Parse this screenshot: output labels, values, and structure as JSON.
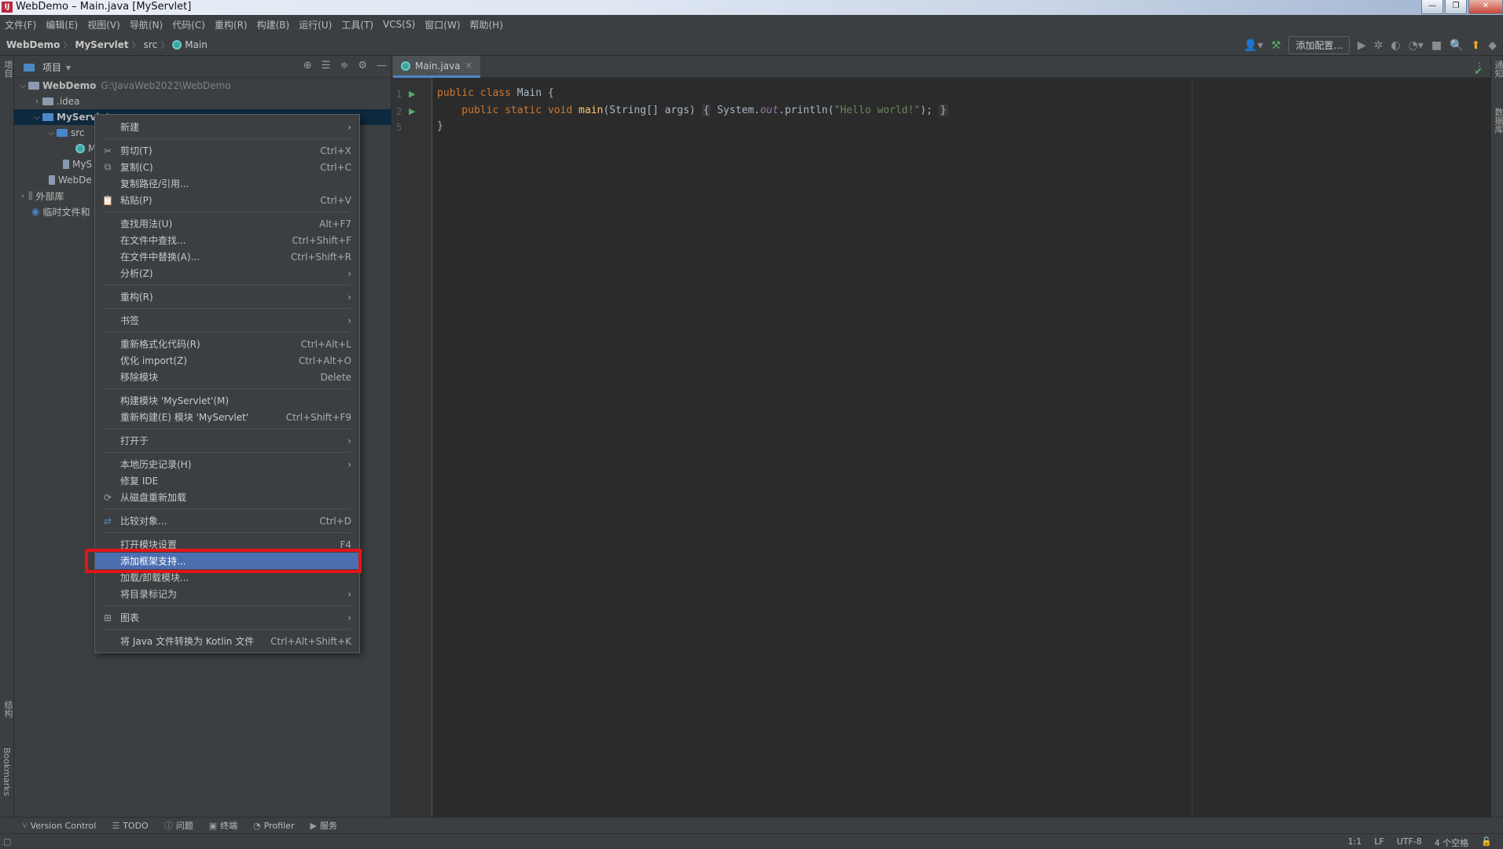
{
  "window": {
    "title": "WebDemo – Main.java [MyServlet]",
    "controls": [
      "minimize-icon",
      "restore-icon",
      "close-icon"
    ]
  },
  "menubar": {
    "items": [
      "文件(F)",
      "编辑(E)",
      "视图(V)",
      "导航(N)",
      "代码(C)",
      "重构(R)",
      "构建(B)",
      "运行(U)",
      "工具(T)",
      "VCS(S)",
      "窗口(W)",
      "帮助(H)"
    ]
  },
  "navbar": {
    "breadcrumbs": [
      "WebDemo",
      "MyServlet",
      "src",
      "Main"
    ],
    "add_config": "添加配置..."
  },
  "left_strip": {
    "top_label": "项目",
    "structure_label": "结构",
    "bookmarks_label": "Bookmarks"
  },
  "right_strip": {
    "notifications_label": "通知",
    "database_label": "数据库"
  },
  "project_panel": {
    "title": "项目",
    "tree": [
      {
        "label": "WebDemo",
        "path": "G:\\JavaWeb2022\\WebDemo"
      },
      {
        "label": ".idea"
      },
      {
        "label": "MyServlet"
      },
      {
        "label": "src"
      },
      {
        "label": "M"
      },
      {
        "label": "MyS"
      },
      {
        "label": "WebDe"
      },
      {
        "label": "外部库"
      },
      {
        "label": "临时文件和"
      }
    ]
  },
  "editor": {
    "tab_label": "Main.java",
    "line_numbers": [
      "1",
      "2",
      "5"
    ],
    "code": {
      "l1_kw": "public class ",
      "l1_name": "Main {",
      "l2_kw": "    public static void ",
      "l2_fn": "main",
      "l2_args": "(String[] args) ",
      "l2_open": "{",
      "l2_body1": " System.",
      "l2_out": "out",
      "l2_body2": ".println(",
      "l2_str": "\"Hello world!\"",
      "l2_end": "); ",
      "l2_close": "}",
      "l3": "}"
    }
  },
  "context_menu": {
    "items": [
      {
        "label": "新建",
        "shortcut": "",
        "submenu": true
      },
      {
        "label": "剪切(T)",
        "shortcut": "Ctrl+X"
      },
      {
        "label": "复制(C)",
        "shortcut": "Ctrl+C"
      },
      {
        "label": "复制路径/引用...",
        "shortcut": ""
      },
      {
        "label": "粘贴(P)",
        "shortcut": "Ctrl+V"
      },
      {
        "label": "查找用法(U)",
        "shortcut": "Alt+F7"
      },
      {
        "label": "在文件中查找...",
        "shortcut": "Ctrl+Shift+F"
      },
      {
        "label": "在文件中替换(A)...",
        "shortcut": "Ctrl+Shift+R"
      },
      {
        "label": "分析(Z)",
        "shortcut": "",
        "submenu": true
      },
      {
        "label": "重构(R)",
        "shortcut": "",
        "submenu": true
      },
      {
        "label": "书签",
        "shortcut": "",
        "submenu": true
      },
      {
        "label": "重新格式化代码(R)",
        "shortcut": "Ctrl+Alt+L"
      },
      {
        "label": "优化 import(Z)",
        "shortcut": "Ctrl+Alt+O"
      },
      {
        "label": "移除模块",
        "shortcut": "Delete"
      },
      {
        "label": "构建模块 'MyServlet'(M)",
        "shortcut": ""
      },
      {
        "label": "重新构建(E) 模块 'MyServlet'",
        "shortcut": "Ctrl+Shift+F9"
      },
      {
        "label": "打开于",
        "shortcut": "",
        "submenu": true
      },
      {
        "label": "本地历史记录(H)",
        "shortcut": "",
        "submenu": true
      },
      {
        "label": "修复 IDE",
        "shortcut": ""
      },
      {
        "label": "从磁盘重新加载",
        "shortcut": ""
      },
      {
        "label": "比较对象...",
        "shortcut": "Ctrl+D"
      },
      {
        "label": "打开模块设置",
        "shortcut": "F4"
      },
      {
        "label": "添加框架支持...",
        "shortcut": "",
        "highlighted": true
      },
      {
        "label": "加载/卸载模块...",
        "shortcut": ""
      },
      {
        "label": "将目录标记为",
        "shortcut": "",
        "submenu": true
      },
      {
        "label": "图表",
        "shortcut": "",
        "submenu": true
      },
      {
        "label": "将 Java 文件转换为 Kotlin 文件",
        "shortcut": "Ctrl+Alt+Shift+K"
      }
    ]
  },
  "bottom_tools": [
    "Version Control",
    "TODO",
    "问题",
    "终端",
    "Profiler",
    "服务"
  ],
  "status": {
    "position": "1:1",
    "line_sep": "LF",
    "encoding": "UTF-8",
    "indent": "4 个空格"
  },
  "colors": {
    "highlight": "#4b6eaf",
    "annotation_box": "#e3141a",
    "bg": "#2b2b2b",
    "panel": "#3c3f41"
  }
}
